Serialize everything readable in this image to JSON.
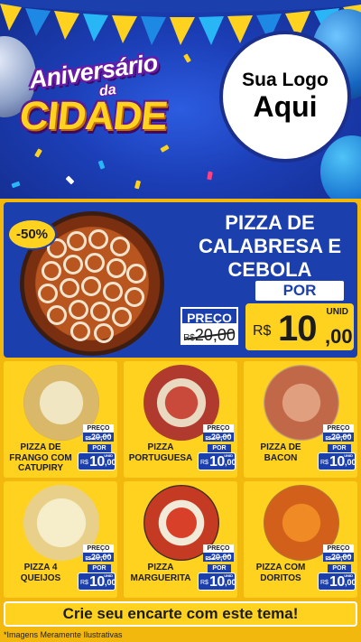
{
  "header": {
    "title_line1": "Aniversário",
    "title_line2": "da",
    "title_line3": "CIDADE",
    "logo_line1": "Sua Logo",
    "logo_line2": "Aqui"
  },
  "featured": {
    "badge": "-50%",
    "name": "PIZZA DE CALABRESA E CEBOLA",
    "por_label": "POR",
    "preco_label": "PREÇO",
    "old_currency": "R$",
    "old_price": "20,00",
    "currency": "R$",
    "price_int": "10",
    "price_dec": ",00",
    "unit": "UNID"
  },
  "products": [
    {
      "name": "PIZZA DE FRANGO COM CATUPIRY",
      "preco_label": "PREÇO",
      "old_currency": "R$",
      "old_price": "20,00",
      "por_label": "POR",
      "currency": "R$",
      "price_int": "10",
      "price_dec": ",00",
      "unit": "UNID"
    },
    {
      "name": "PIZZA PORTUGUESA",
      "preco_label": "PREÇO",
      "old_currency": "R$",
      "old_price": "20,00",
      "por_label": "POR",
      "currency": "R$",
      "price_int": "10",
      "price_dec": ",00",
      "unit": "UNID"
    },
    {
      "name": "PIZZA DE BACON",
      "preco_label": "PREÇO",
      "old_currency": "R$",
      "old_price": "20,00",
      "por_label": "POR",
      "currency": "R$",
      "price_int": "10",
      "price_dec": ",00",
      "unit": "UNID"
    },
    {
      "name": "PIZZA 4 QUEIJOS",
      "preco_label": "PREÇO",
      "old_currency": "R$",
      "old_price": "20,00",
      "por_label": "POR",
      "currency": "R$",
      "price_int": "10",
      "price_dec": ",00",
      "unit": "UNID"
    },
    {
      "name": "PIZZA MARGUERITA",
      "preco_label": "PREÇO",
      "old_currency": "R$",
      "old_price": "20,00",
      "por_label": "POR",
      "currency": "R$",
      "price_int": "10",
      "price_dec": ",00",
      "unit": "UNID"
    },
    {
      "name": "PIZZA COM DORITOS",
      "preco_label": "PREÇO",
      "old_currency": "R$",
      "old_price": "20,00",
      "por_label": "POR",
      "currency": "R$",
      "price_int": "10",
      "price_dec": ",00",
      "unit": "UNID"
    }
  ],
  "footer": {
    "cta": "Crie seu encarte com este tema!",
    "disclaimer": "*Imagens Meramente Ilustrativas"
  },
  "colors": {
    "blue": "#1c3fae",
    "yellow": "#ffd21f",
    "gold_background": "#f3b80e"
  }
}
